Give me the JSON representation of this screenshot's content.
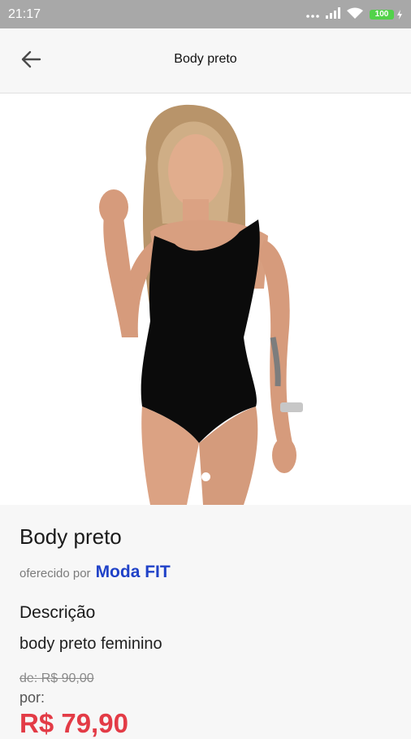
{
  "status_bar": {
    "time": "21:17",
    "battery": "100"
  },
  "app_bar": {
    "title": "Body preto"
  },
  "product": {
    "name": "Body preto",
    "offered_by_prefix": "oferecido por",
    "seller": "Moda FIT",
    "description_heading": "Descrição",
    "description": "body preto feminino",
    "old_price": "de: R$ 90,00",
    "price_label": "por:",
    "price": "R$ 79,90"
  },
  "colors": {
    "seller_link": "#2042c8",
    "price": "#e33b46",
    "battery": "#52d24a"
  },
  "icons": {
    "back": "arrow-left-icon",
    "signal": "signal-icon",
    "wifi": "wifi-icon",
    "battery": "battery-icon"
  },
  "carousel": {
    "current_index": 1,
    "total": 1
  }
}
